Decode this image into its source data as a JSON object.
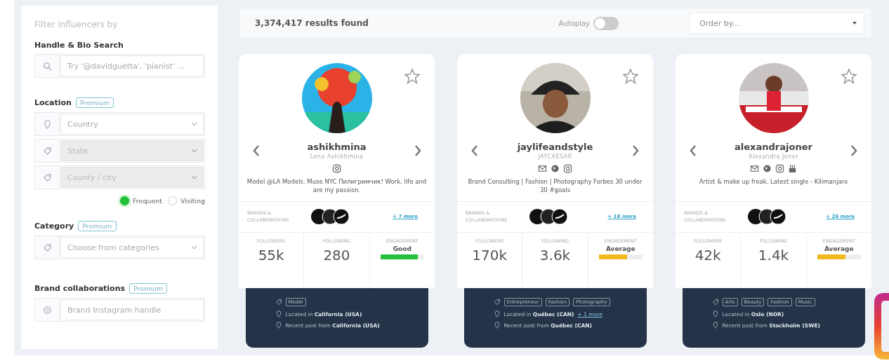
{
  "sidebar": {
    "title": "Filter influencers by",
    "handle_search": {
      "label": "Handle & Bio Search",
      "placeholder": "Try '@davidguetta', 'pianist' ..."
    },
    "location": {
      "label": "Location",
      "badge": "Premium",
      "fields": [
        {
          "placeholder": "Country",
          "disabled": false
        },
        {
          "placeholder": "State",
          "disabled": true
        },
        {
          "placeholder": "County / city",
          "disabled": true
        }
      ],
      "options": [
        {
          "label": "Frequent",
          "selected": true
        },
        {
          "label": "Visiting",
          "selected": false
        }
      ]
    },
    "category": {
      "label": "Category",
      "badge": "Premium",
      "placeholder": "Choose from categories"
    },
    "brands": {
      "label": "Brand collaborations",
      "badge": "Premium",
      "placeholder": "Brand Instagram handle"
    }
  },
  "toolbar": {
    "results": "3,374,417 results found",
    "autoplay": {
      "label": "Autoplay",
      "on": false
    },
    "order": {
      "placeholder": "Order by..."
    }
  },
  "cards": [
    {
      "username": "ashikhmina",
      "name": "Lena Ashikhmina",
      "contacts": [
        {
          "kind": "instagram"
        }
      ],
      "bio": "Model @LA Models. Muse NYC Пилигримчик! Work, life and are my passion.",
      "brands_label": "BRANDS & COLLABORATIONS",
      "more": "+ 7 more",
      "stats": [
        {
          "label": "FOLLOWERS",
          "value": "55k"
        },
        {
          "label": "FOLLOWING",
          "value": "280"
        }
      ],
      "engagement": {
        "label": "ENGAGEMENT",
        "value": "Good",
        "level": 0.85,
        "color": "#22c03a"
      },
      "tags": [
        "Model"
      ],
      "located": "Located in **California (USA)**",
      "recent": "Recent post from **California (USA)**"
    },
    {
      "username": "jaylifeandstyle",
      "name": "JAYCAESAR",
      "contacts": [
        {
          "kind": "email"
        },
        {
          "kind": "globe"
        },
        {
          "kind": "instagram"
        }
      ],
      "bio": "Brand Consulting | Fashion | Photography Forbes 30 under 30 #goals",
      "brands_label": "BRANDS & COLLABORATIONS",
      "more": "+ 18 more",
      "stats": [
        {
          "label": "FOLLOWERS",
          "value": "170k"
        },
        {
          "label": "FOLLOWING",
          "value": "3.6k"
        }
      ],
      "engagement": {
        "label": "ENGAGEMENT",
        "value": "Average",
        "level": 0.65,
        "color": "#f2b91c"
      },
      "tags": [
        "Entrepreneur",
        "Fashion",
        "Photography"
      ],
      "located": "Located in **Québec (CAN)**",
      "located_more": "+ 1 more",
      "recent": "Recent post from **Québec (CAN)**"
    },
    {
      "username": "alexandrajoner",
      "name": "Alexandra Joner",
      "contacts": [
        {
          "kind": "email"
        },
        {
          "kind": "globe"
        },
        {
          "kind": "instagram"
        },
        {
          "kind": "youtube"
        }
      ],
      "bio": "Artist & make up freak. Latest single - Kilimanjaro",
      "brands_label": "BRANDS & COLLABORATIONS",
      "more": "+ 26 more",
      "stats": [
        {
          "label": "FOLLOWERS",
          "value": "42k"
        },
        {
          "label": "FOLLOWING",
          "value": "1.4k"
        }
      ],
      "engagement": {
        "label": "ENGAGEMENT",
        "value": "Average",
        "level": 0.65,
        "color": "#f2b91c"
      },
      "tags": [
        "Arts",
        "Beauty",
        "Fashion",
        "Music"
      ],
      "located": "Located in **Oslo (NOR)**",
      "recent": "Recent post from **Stockholm (SWE)**"
    }
  ]
}
